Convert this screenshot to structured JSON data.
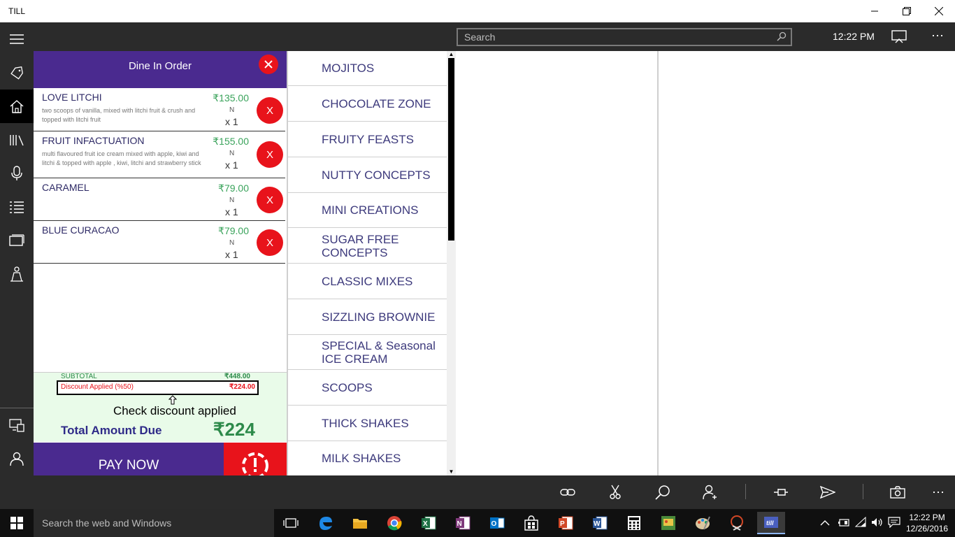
{
  "window": {
    "title": "TILL"
  },
  "search": {
    "placeholder": "Search"
  },
  "clock": {
    "time": "12:22 PM"
  },
  "order": {
    "header": "Dine In Order",
    "items": [
      {
        "name": "LOVE LITCHI",
        "desc": "two scoops of vanilla, mixed with litchi fruit & crush and topped with litchi fruit",
        "price": "₹135.00",
        "flag": "N",
        "qty": "x 1",
        "remove": "X"
      },
      {
        "name": "FRUIT INFACTUATION",
        "desc": "multi flavoured fruit ice cream mixed with apple, kiwi and litchi & topped with apple , kiwi, litchi and strawberry stick",
        "price": "₹155.00",
        "flag": "N",
        "qty": "x 1",
        "remove": "X"
      },
      {
        "name": "CARAMEL",
        "desc": "",
        "price": "₹79.00",
        "flag": "N",
        "qty": "x 1",
        "remove": "X"
      },
      {
        "name": "BLUE CURACAO",
        "desc": "",
        "price": "₹79.00",
        "flag": "N",
        "qty": "x 1",
        "remove": "X"
      }
    ],
    "subtotal_label": "SUBTOTAL",
    "subtotal_value": "₹448.00",
    "discount_label": "Discount Applied  (%50)",
    "discount_value": "₹224.00",
    "tooltip": "Check discount applied",
    "total_label": "Total Amount Due",
    "total_value": "₹224",
    "pay_label": "PAY NOW"
  },
  "categories": [
    "MOJITOS",
    "CHOCOLATE ZONE",
    "FRUITY FEASTS",
    "NUTTY CONCEPTS",
    "MINI CREATIONS",
    "SUGAR FREE CONCEPTS",
    "CLASSIC MIXES",
    "SIZZLING BROWNIE",
    "SPECIAL & Seasonal ICE CREAM",
    "SCOOPS",
    "THICK SHAKES",
    "MILK SHAKES"
  ],
  "taskbar": {
    "search_placeholder": "Search the web and Windows",
    "time": "12:22 PM",
    "date": "12/26/2016"
  },
  "colors": {
    "accent_purple": "#4a2a8f",
    "remove_red": "#e8131b",
    "price_green": "#3aa35b",
    "category_text": "#3d3a7c"
  }
}
